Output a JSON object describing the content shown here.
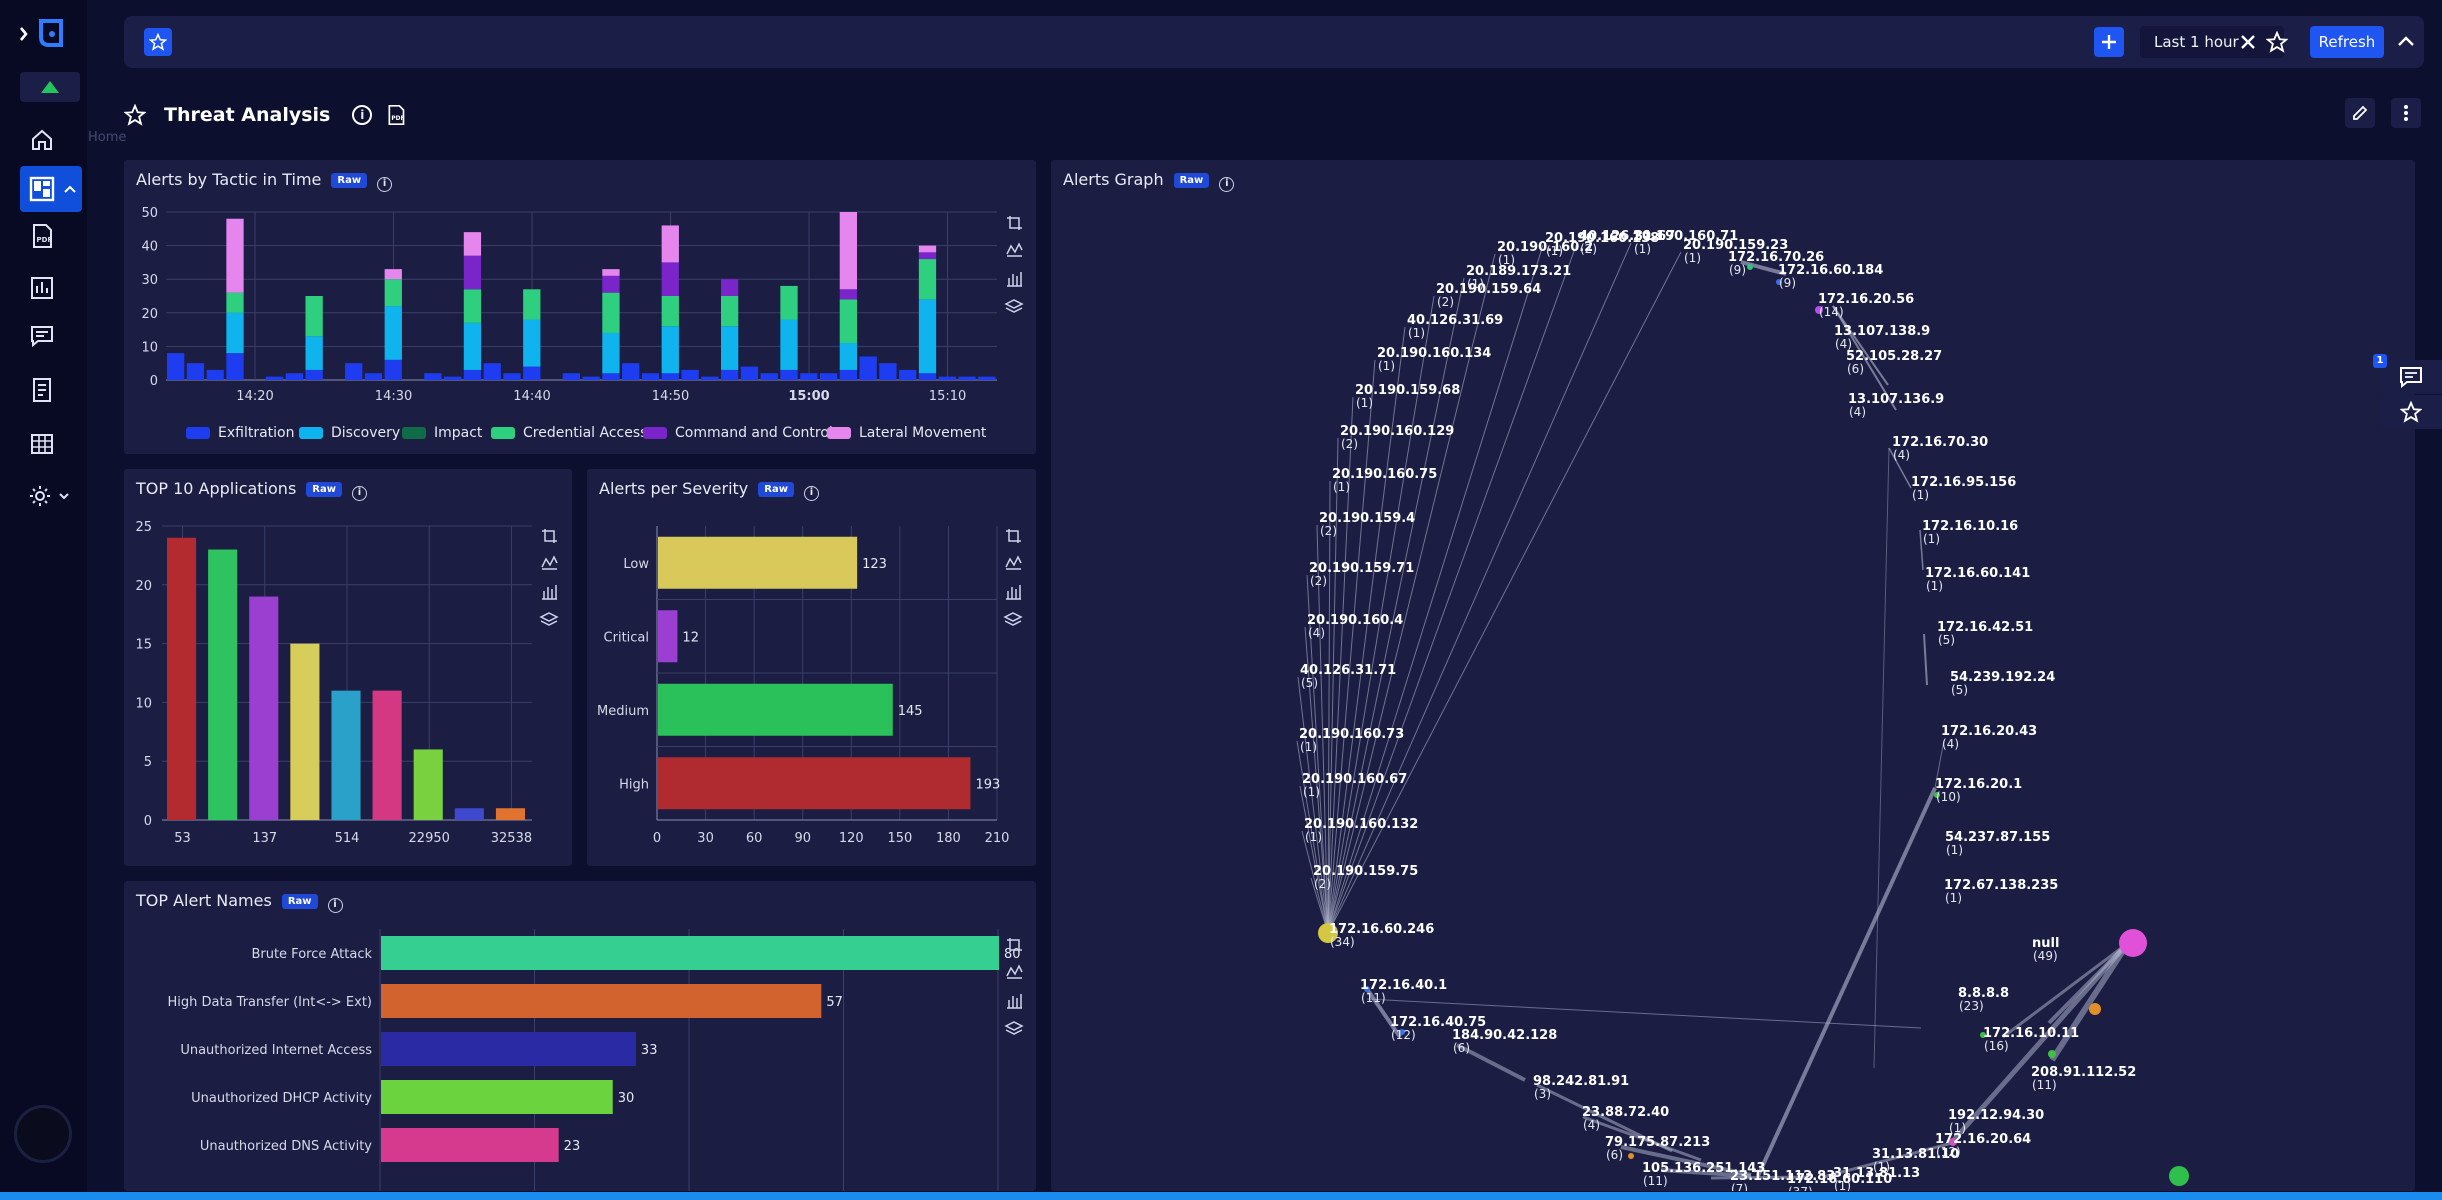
{
  "topbar": {
    "range_label": "Last 1 hour",
    "refresh_label": "Refresh"
  },
  "page": {
    "title": "Threat Analysis",
    "breadcrumb": "Home"
  },
  "raw_badge": "Raw",
  "panels": {
    "tactic": {
      "title": "Alerts by Tactic in Time"
    },
    "graph": {
      "title": "Alerts Graph"
    },
    "apps": {
      "title": "TOP 10 Applications"
    },
    "severity": {
      "title": "Alerts per Severity"
    },
    "names": {
      "title": "TOP Alert Names"
    }
  },
  "right_dock": {
    "badge": "1"
  },
  "colors": {
    "exfiltration": "#1f3df0",
    "discovery": "#0fb4ee",
    "impact": "#0f6b48",
    "credential": "#2ecf7f",
    "command": "#7a25c9",
    "lateral": "#e486ee"
  },
  "chart_data": [
    {
      "type": "bar",
      "title": "Alerts by Tactic in Time",
      "ylim": [
        0,
        50
      ],
      "yticks": [
        "0",
        "10",
        "20",
        "30",
        "40",
        "50"
      ],
      "xticks": [
        "14:20",
        "14:30",
        "14:40",
        "14:50",
        "15:00",
        "15:10"
      ],
      "legend": [
        "Exfiltration",
        "Discovery",
        "Impact",
        "Credential Access",
        "Command and Control",
        "Lateral Movement"
      ],
      "stacks": [
        {
          "t": 0,
          "v": [
            8,
            0,
            0,
            0,
            0,
            0
          ]
        },
        {
          "t": 1,
          "v": [
            5,
            0,
            0,
            0,
            0,
            0
          ]
        },
        {
          "t": 2,
          "v": [
            3,
            0,
            0,
            0,
            0,
            0
          ]
        },
        {
          "t": 3,
          "v": [
            8,
            12,
            0,
            6,
            0,
            22
          ]
        },
        {
          "t": 5,
          "v": [
            1,
            0,
            0,
            0,
            0,
            0
          ]
        },
        {
          "t": 6,
          "v": [
            2,
            0,
            0,
            0,
            0,
            0
          ]
        },
        {
          "t": 7,
          "v": [
            3,
            10,
            0,
            12,
            0,
            0
          ]
        },
        {
          "t": 9,
          "v": [
            5,
            0,
            0,
            0,
            0,
            0
          ]
        },
        {
          "t": 10,
          "v": [
            2,
            0,
            0,
            0,
            0,
            0
          ]
        },
        {
          "t": 11,
          "v": [
            6,
            16,
            0,
            8,
            0,
            3
          ]
        },
        {
          "t": 13,
          "v": [
            2,
            0,
            0,
            0,
            0,
            0
          ]
        },
        {
          "t": 14,
          "v": [
            1,
            0,
            0,
            0,
            0,
            0
          ]
        },
        {
          "t": 15,
          "v": [
            3,
            14,
            0,
            10,
            10,
            7
          ]
        },
        {
          "t": 16,
          "v": [
            5,
            0,
            0,
            0,
            0,
            0
          ]
        },
        {
          "t": 17,
          "v": [
            2,
            0,
            0,
            0,
            0,
            0
          ]
        },
        {
          "t": 18,
          "v": [
            4,
            14,
            0,
            9,
            0,
            0
          ]
        },
        {
          "t": 20,
          "v": [
            2,
            0,
            0,
            0,
            0,
            0
          ]
        },
        {
          "t": 21,
          "v": [
            1,
            0,
            0,
            0,
            0,
            0
          ]
        },
        {
          "t": 22,
          "v": [
            2,
            12,
            0,
            12,
            5,
            2
          ]
        },
        {
          "t": 23,
          "v": [
            5,
            0,
            0,
            0,
            0,
            0
          ]
        },
        {
          "t": 24,
          "v": [
            2,
            0,
            0,
            0,
            0,
            0
          ]
        },
        {
          "t": 25,
          "v": [
            2,
            14,
            0,
            9,
            10,
            11
          ]
        },
        {
          "t": 26,
          "v": [
            3,
            0,
            0,
            0,
            0,
            0
          ]
        },
        {
          "t": 27,
          "v": [
            1,
            0,
            0,
            0,
            0,
            0
          ]
        },
        {
          "t": 28,
          "v": [
            3,
            13,
            0,
            9,
            5,
            0
          ]
        },
        {
          "t": 29,
          "v": [
            4,
            0,
            0,
            0,
            0,
            0
          ]
        },
        {
          "t": 30,
          "v": [
            2,
            0,
            0,
            0,
            0,
            0
          ]
        },
        {
          "t": 31,
          "v": [
            3,
            15,
            0,
            10,
            0,
            0
          ]
        },
        {
          "t": 32,
          "v": [
            2,
            0,
            0,
            0,
            0,
            0
          ]
        },
        {
          "t": 33,
          "v": [
            2,
            0,
            0,
            0,
            0,
            0
          ]
        },
        {
          "t": 34,
          "v": [
            3,
            8,
            0,
            13,
            3,
            23
          ]
        },
        {
          "t": 35,
          "v": [
            7,
            0,
            0,
            0,
            0,
            0
          ]
        },
        {
          "t": 36,
          "v": [
            5,
            0,
            0,
            0,
            0,
            0
          ]
        },
        {
          "t": 37,
          "v": [
            3,
            0,
            0,
            0,
            0,
            0
          ]
        },
        {
          "t": 38,
          "v": [
            2,
            22,
            0,
            12,
            2,
            2
          ]
        },
        {
          "t": 39,
          "v": [
            1,
            0,
            0,
            0,
            0,
            0
          ]
        },
        {
          "t": 40,
          "v": [
            1,
            0,
            0,
            0,
            0,
            0
          ]
        },
        {
          "t": 41,
          "v": [
            1,
            0,
            0,
            0,
            0,
            0
          ]
        }
      ]
    },
    {
      "type": "bar",
      "title": "TOP 10 Applications",
      "ylim": [
        0,
        25
      ],
      "yticks": [
        "0",
        "5",
        "10",
        "15",
        "20",
        "25"
      ],
      "xticks": [
        "53",
        "137",
        "514",
        "22950",
        "32538"
      ],
      "values": [
        24,
        23,
        19,
        15,
        11,
        11,
        6,
        1,
        1
      ],
      "colors": [
        "#b32b2e",
        "#2ec260",
        "#9a3fd0",
        "#d7cd5b",
        "#2aa1c9",
        "#d53883",
        "#79d13f",
        "#3f49cf",
        "#e0742f"
      ]
    },
    {
      "type": "bar",
      "title": "Alerts per Severity",
      "categories": [
        "Low",
        "Critical",
        "Medium",
        "High"
      ],
      "values": [
        123,
        12,
        145,
        193
      ],
      "colors": [
        "#d8c95a",
        "#9b3fd3",
        "#2bc15a",
        "#b02b2f"
      ],
      "xlim": [
        0,
        210
      ],
      "xticks": [
        "0",
        "30",
        "60",
        "90",
        "120",
        "150",
        "180",
        "210"
      ],
      "value_labels": [
        "123",
        "12",
        "145",
        "193"
      ]
    },
    {
      "type": "bar",
      "title": "TOP Alert Names",
      "categories": [
        "Brute Force Attack",
        "High Data Transfer (Int<-> Ext)",
        "Unauthorized Internet Access",
        "Unauthorized DHCP Activity",
        "Unauthorized DNS Activity"
      ],
      "values": [
        80,
        57,
        33,
        30,
        23
      ],
      "xlim": [
        0,
        80
      ],
      "colors": [
        "#36cf92",
        "#d2632f",
        "#2b2aa5",
        "#6ad33d",
        "#d53a8f"
      ],
      "value_labels": [
        "80",
        "57",
        "33",
        "30",
        "23"
      ]
    }
  ],
  "graph": {
    "nodes": [
      {
        "ip": "20.190.159.75",
        "count": "(2)"
      },
      {
        "ip": "20.190.160.132",
        "count": "(1)"
      },
      {
        "ip": "20.190.160.67",
        "count": "(1)"
      },
      {
        "ip": "20.190.160.73",
        "count": "(1)"
      },
      {
        "ip": "40.126.31.71",
        "count": "(5)"
      },
      {
        "ip": "20.190.160.4",
        "count": "(4)"
      },
      {
        "ip": "20.190.159.71",
        "count": "(2)"
      },
      {
        "ip": "20.190.159.4",
        "count": "(2)"
      },
      {
        "ip": "20.190.160.75",
        "count": "(1)"
      },
      {
        "ip": "20.190.160.129",
        "count": "(2)"
      },
      {
        "ip": "20.190.159.68",
        "count": "(1)"
      },
      {
        "ip": "20.190.160.134",
        "count": "(1)"
      },
      {
        "ip": "40.126.31.69",
        "count": "(1)"
      },
      {
        "ip": "20.190.159.64",
        "count": "(2)"
      },
      {
        "ip": "20.189.173.21",
        "count": "(1)"
      },
      {
        "ip": "20.190.160.2",
        "count": "(1)"
      },
      {
        "ip": "20.190.160.138",
        "count": "(1)"
      },
      {
        "ip": "40.126.31.67",
        "count": "(2)"
      },
      {
        "ip": "20.190.160.71",
        "count": "(1)"
      },
      {
        "ip": "20.190.159.23",
        "count": "(1)"
      },
      {
        "ip": "172.16.70.26",
        "count": "(9)"
      },
      {
        "ip": "172.16.60.184",
        "count": "(9)"
      },
      {
        "ip": "172.16.20.56",
        "count": "(14)"
      },
      {
        "ip": "13.107.138.9",
        "count": "(4)"
      },
      {
        "ip": "52.105.28.27",
        "count": "(6)"
      },
      {
        "ip": "13.107.136.9",
        "count": "(4)"
      },
      {
        "ip": "172.16.70.30",
        "count": "(4)"
      },
      {
        "ip": "172.16.95.156",
        "count": "(1)"
      },
      {
        "ip": "172.16.10.16",
        "count": "(1)"
      },
      {
        "ip": "172.16.60.141",
        "count": "(1)"
      },
      {
        "ip": "172.16.42.51",
        "count": "(5)"
      },
      {
        "ip": "54.239.192.24",
        "count": "(5)"
      },
      {
        "ip": "172.16.20.43",
        "count": "(4)"
      },
      {
        "ip": "172.16.20.1",
        "count": "(10)"
      },
      {
        "ip": "54.237.87.155",
        "count": "(1)"
      },
      {
        "ip": "172.67.138.235",
        "count": "(1)"
      },
      {
        "ip": "null",
        "count": "(49)"
      },
      {
        "ip": "8.8.8.8",
        "count": "(23)"
      },
      {
        "ip": "172.16.10.11",
        "count": "(16)"
      },
      {
        "ip": "208.91.112.52",
        "count": "(11)"
      },
      {
        "ip": "192.12.94.30",
        "count": "(1)"
      },
      {
        "ip": "172.16.20.64",
        "count": "(12)"
      },
      {
        "ip": "31.13.81.10",
        "count": "(1)"
      },
      {
        "ip": "31.13.81.13",
        "count": "(1)"
      },
      {
        "ip": "172.16.60.110",
        "count": "(37)"
      },
      {
        "ip": "23.151.112.83",
        "count": "(7)"
      },
      {
        "ip": "105.136.251.143",
        "count": "(11)"
      },
      {
        "ip": "79.175.87.213",
        "count": "(6)"
      },
      {
        "ip": "23.88.72.40",
        "count": "(4)"
      },
      {
        "ip": "98.242.81.91",
        "count": "(3)"
      },
      {
        "ip": "184.90.42.128",
        "count": "(6)"
      },
      {
        "ip": "172.16.40.75",
        "count": "(12)"
      },
      {
        "ip": "172.16.40.1",
        "count": "(11)"
      },
      {
        "ip": "172.16.60.246",
        "count": "(34)"
      }
    ]
  }
}
